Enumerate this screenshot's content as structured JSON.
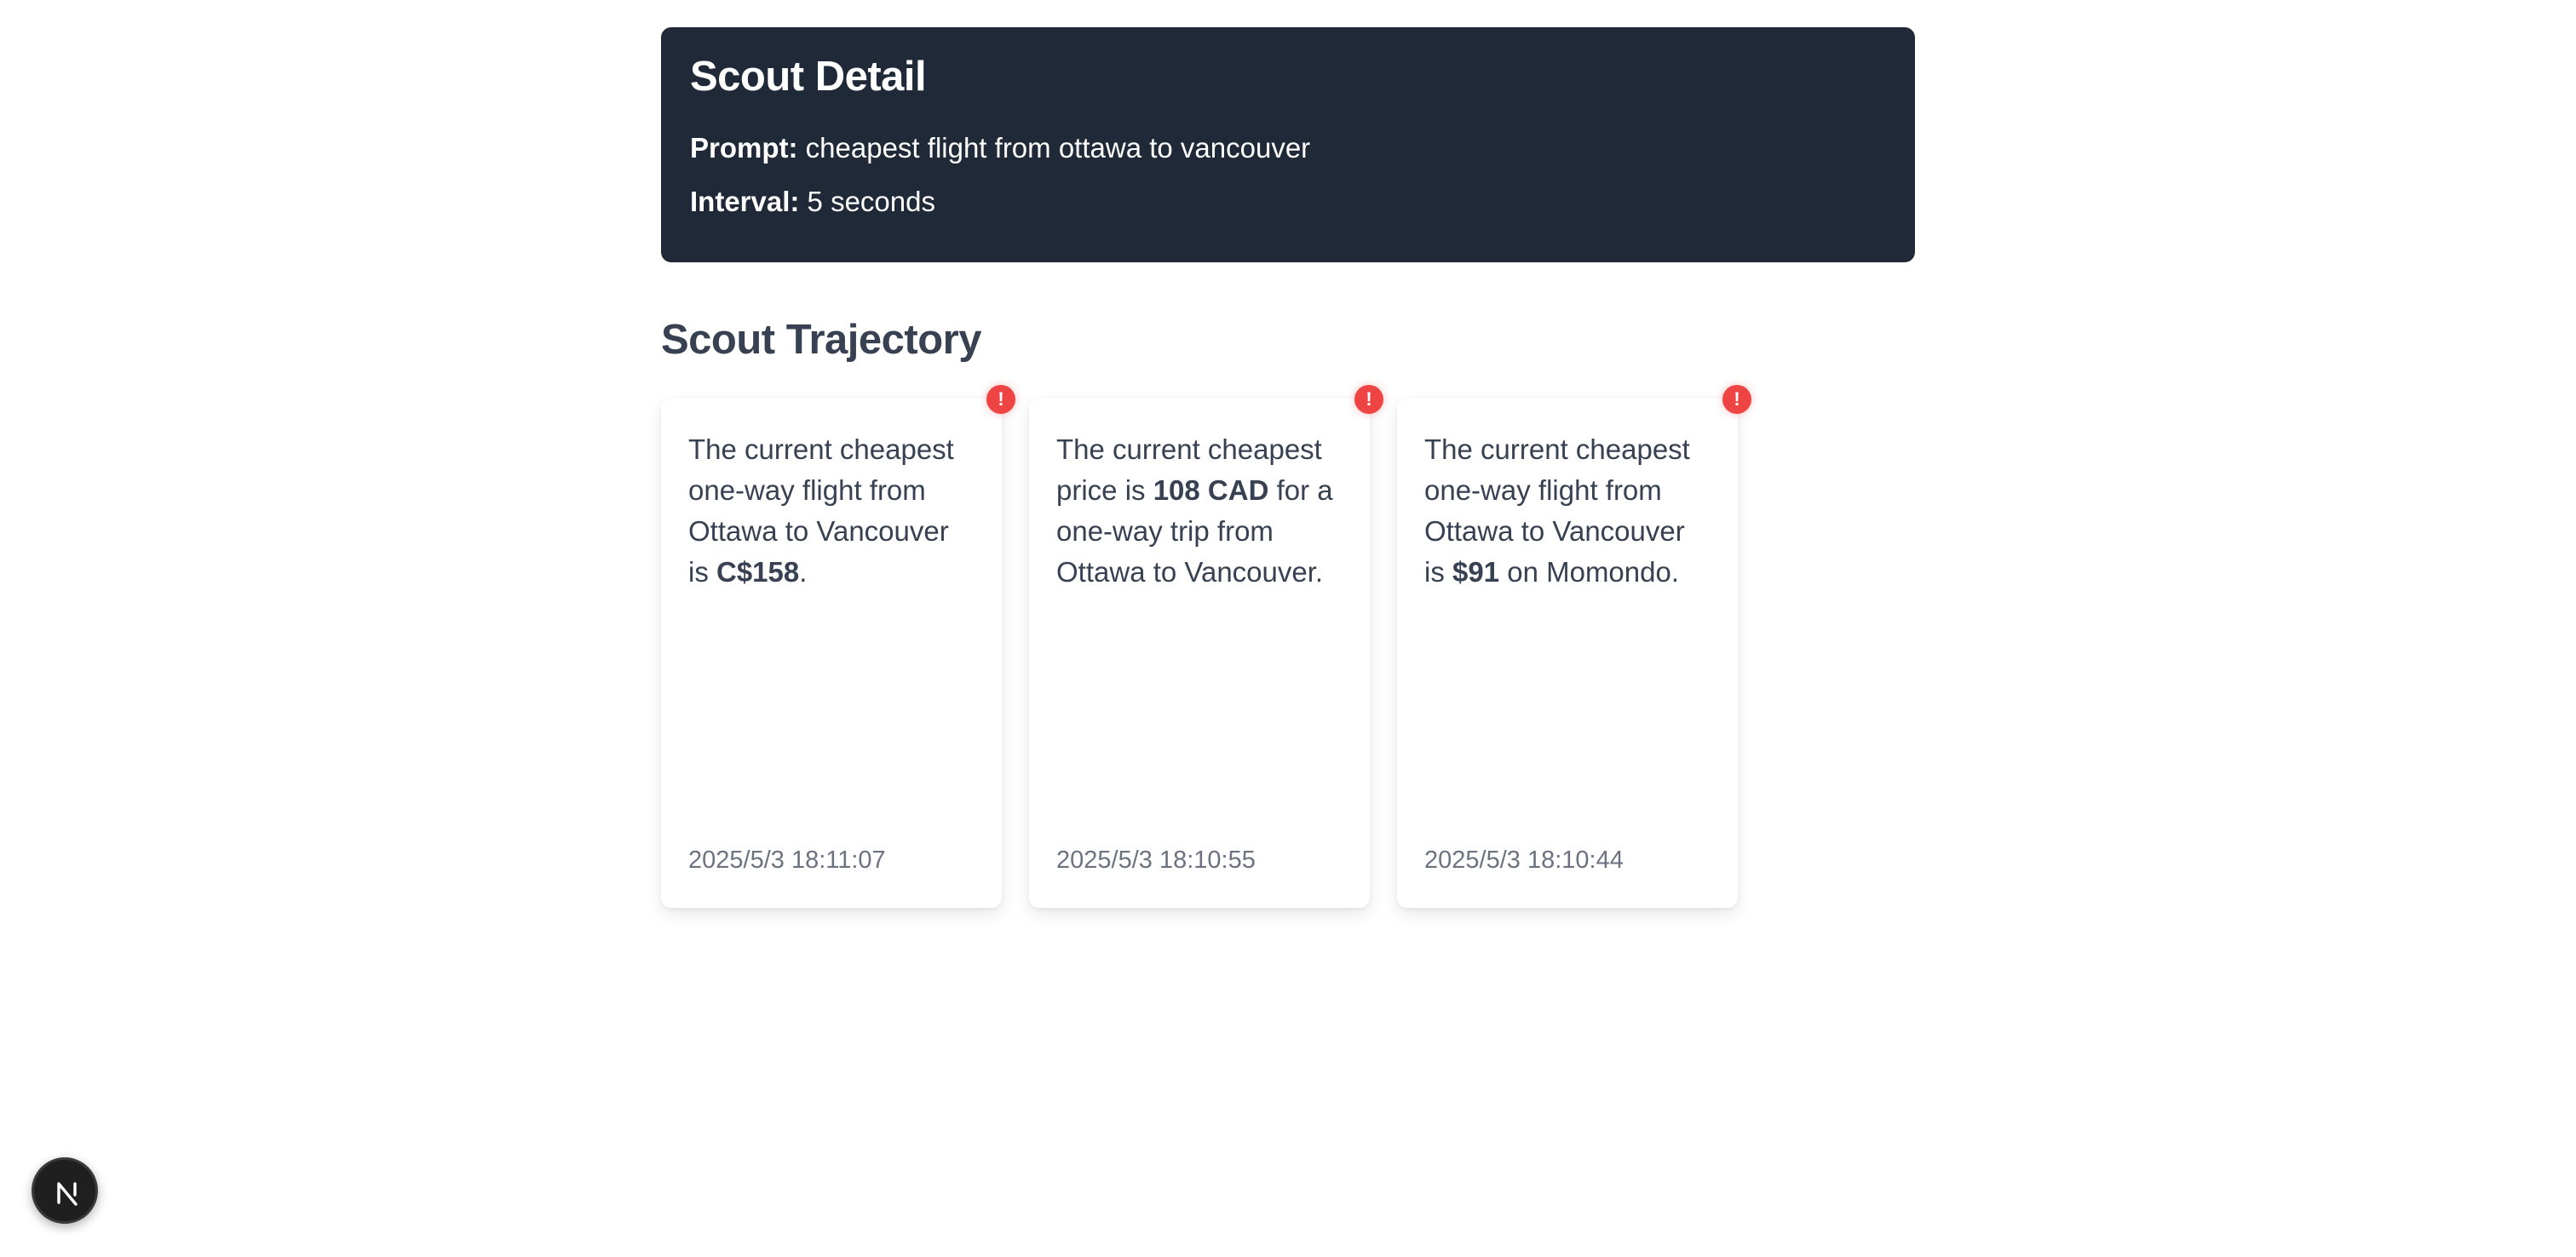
{
  "scout_detail": {
    "title": "Scout Detail",
    "prompt_label": "Prompt:",
    "prompt_value": "cheapest flight from ottawa to vancouver",
    "interval_label": "Interval:",
    "interval_value": "5 seconds"
  },
  "trajectory": {
    "title": "Scout Trajectory",
    "cards": [
      {
        "text_before": "The current cheapest one-way flight from Ottawa to Vancouver is ",
        "text_bold": "C$158",
        "text_after": ".",
        "timestamp": "2025/5/3 18:11:07",
        "badge": "!"
      },
      {
        "text_before": "The current cheapest price is ",
        "text_bold": "108 CAD",
        "text_after": " for a one-way trip from Ottawa to Vancouver.",
        "timestamp": "2025/5/3 18:10:55",
        "badge": "!"
      },
      {
        "text_before": "The current cheapest one-way flight from Ottawa to Vancouver is ",
        "text_bold": "$91",
        "text_after": " on Momondo.",
        "timestamp": "2025/5/3 18:10:44",
        "badge": "!"
      }
    ]
  },
  "colors": {
    "header_bg": "#1f2937",
    "heading_text": "#374151",
    "timestamp_text": "#6b7280",
    "alert_badge": "#ef4444"
  },
  "icons": {
    "alert": "alert-icon",
    "dev_tools": "nextjs-logo-icon"
  }
}
